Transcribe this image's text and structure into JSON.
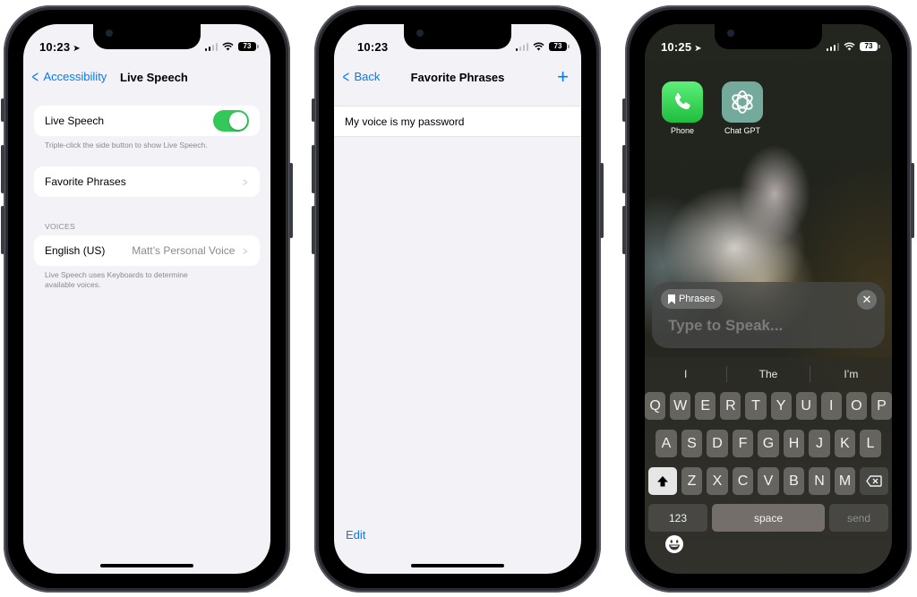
{
  "colors": {
    "ios_blue": "#007aff",
    "toggle_green": "#34c759",
    "group_bg": "#f2f2f7"
  },
  "phone1": {
    "status": {
      "time": "10:23",
      "battery": "73",
      "location_icon": "location-arrow-icon"
    },
    "nav": {
      "back_label": "Accessibility",
      "title": "Live Speech"
    },
    "live_speech_row": {
      "label": "Live Speech",
      "toggle_on": true
    },
    "live_speech_footnote": "Triple-click the side button to show Live Speech.",
    "favorite_phrases_row": {
      "label": "Favorite Phrases"
    },
    "voices_header": "VOICES",
    "voice_row": {
      "label": "English (US)",
      "value": "Matt’s Personal Voice"
    },
    "voices_footnote_line1": "Live Speech uses Keyboards to determine",
    "voices_footnote_line2": "available voices."
  },
  "phone2": {
    "status": {
      "time": "10:23",
      "battery": "73"
    },
    "nav": {
      "back_label": "Back",
      "title": "Favorite Phrases",
      "add_icon": "plus-icon"
    },
    "phrases": [
      {
        "text": "My voice is my password"
      }
    ],
    "edit_label": "Edit"
  },
  "phone3": {
    "status": {
      "time": "10:25",
      "battery": "73",
      "location_icon": "location-arrow-icon"
    },
    "apps": [
      {
        "label": "Phone",
        "icon": "phone-icon",
        "color": "#34c759"
      },
      {
        "label": "Chat GPT",
        "icon": "openai-icon",
        "color": "#74aa9c"
      }
    ],
    "speak_panel": {
      "phrases_label": "Phrases",
      "placeholder": "Type to Speak..."
    },
    "predictions": [
      "I",
      "The",
      "I’m"
    ],
    "keyboard": {
      "row1": [
        "Q",
        "W",
        "E",
        "R",
        "T",
        "Y",
        "U",
        "I",
        "O",
        "P"
      ],
      "row2": [
        "A",
        "S",
        "D",
        "F",
        "G",
        "H",
        "J",
        "K",
        "L"
      ],
      "row3": [
        "Z",
        "X",
        "C",
        "V",
        "B",
        "N",
        "M"
      ],
      "numbers_label": "123",
      "space_label": "space",
      "send_label": "send"
    }
  }
}
